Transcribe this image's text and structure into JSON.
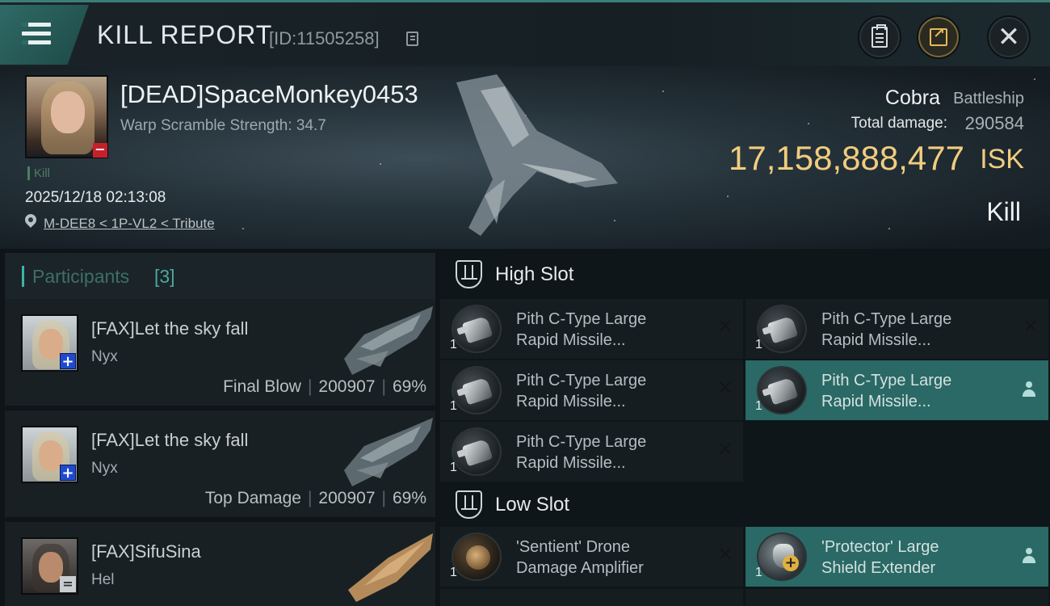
{
  "header": {
    "title": "KILL REPORT",
    "report_id": "[ID:11505258]",
    "icons": [
      "menu-icon",
      "copy-icon",
      "clipboard-icon",
      "share-icon",
      "close-icon"
    ]
  },
  "victim": {
    "name": "[DEAD]SpaceMonkey0453",
    "warp_scramble": "Warp Scramble Strength: 34.7",
    "tag": "Kill",
    "datetime": "2025/12/18 02:13:08",
    "location": "M-DEE8 < 1P-VL2 < Tribute",
    "ship_name": "Cobra",
    "ship_class": "Battleship",
    "total_damage_label": "Total damage:",
    "total_damage": "290584",
    "isk_value": "17,158,888,477",
    "isk_unit": "ISK",
    "result": "Kill"
  },
  "participants": {
    "label": "Participants",
    "count": "[3]",
    "items": [
      {
        "name": "[FAX]Let the sky fall",
        "ship": "Nyx",
        "role": "Final Blow",
        "damage": "200907",
        "percent": "69%",
        "badge": "+"
      },
      {
        "name": "[FAX]Let the sky fall",
        "ship": "Nyx",
        "role": "Top Damage",
        "damage": "200907",
        "percent": "69%",
        "badge": "+"
      },
      {
        "name": "[FAX]SifuSina",
        "ship": "Hel",
        "badge": "="
      }
    ]
  },
  "fitting": {
    "high_slot_label": "High Slot",
    "low_slot_label": "Low Slot",
    "high_slot": [
      {
        "line1": "Pith C-Type Large",
        "line2": "Rapid Missile...",
        "qty": "1",
        "state": "destroyed"
      },
      {
        "line1": "Pith C-Type Large",
        "line2": "Rapid Missile...",
        "qty": "1",
        "state": "destroyed"
      },
      {
        "line1": "Pith C-Type Large",
        "line2": "Rapid Missile...",
        "qty": "1",
        "state": "destroyed"
      },
      {
        "line1": "Pith C-Type Large",
        "line2": "Rapid Missile...",
        "qty": "1",
        "state": "destroyed"
      },
      {
        "line1": "Pith C-Type Large",
        "line2": "Rapid Missile...",
        "qty": "1",
        "state": "dropped"
      }
    ],
    "low_slot": [
      {
        "line1": "'Sentient' Drone",
        "line2": "Damage Amplifier",
        "qty": "1",
        "state": "destroyed"
      },
      {
        "line1": "'Protector' Large",
        "line2": "Shield Extender",
        "qty": "1",
        "state": "dropped"
      }
    ],
    "x_glyph": "✕",
    "colors": {
      "accent": "#2a6965",
      "isk": "#f1cd7e",
      "teal": "#3bb5a9"
    }
  }
}
